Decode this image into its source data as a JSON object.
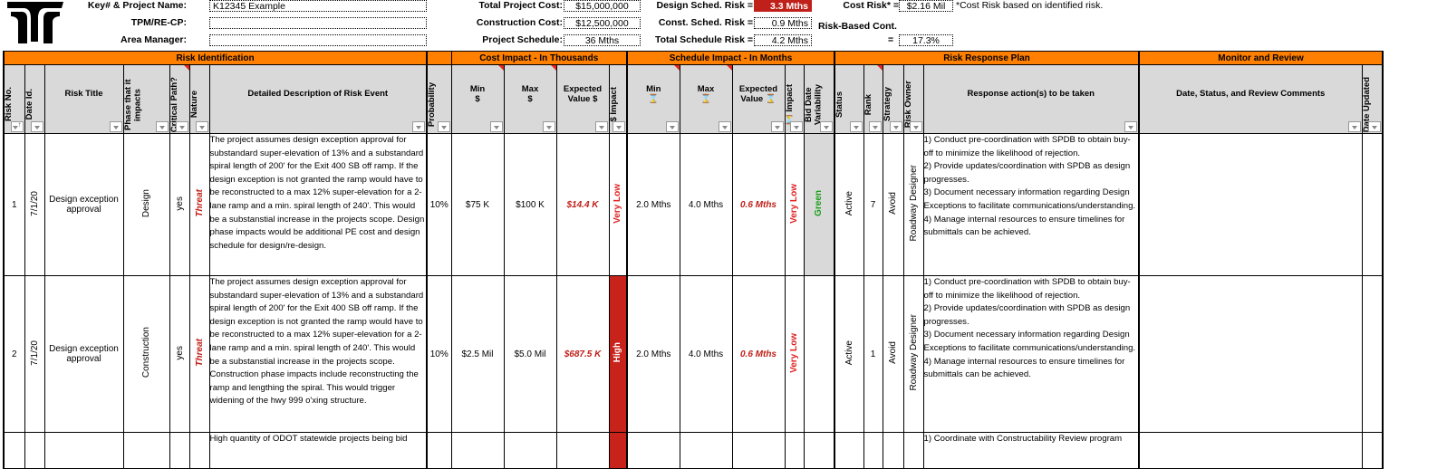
{
  "header": {
    "logo_icon": "odot-logo-icon",
    "fields_left": [
      {
        "label": "Key# & Project Name:",
        "value": "K12345 Example"
      },
      {
        "label": "TPM/RE-CP:",
        "value": ""
      },
      {
        "label": "Area Manager:",
        "value": ""
      }
    ],
    "fields_mid": [
      {
        "label": "Total Project Cost:",
        "value": "$15,000,000"
      },
      {
        "label": "Construction Cost:",
        "value": "$12,500,000"
      },
      {
        "label": "Project Schedule:",
        "value": "36 Mths"
      }
    ],
    "fields_risk": [
      {
        "label": "Design Sched. Risk =",
        "value": "3.3 Mths",
        "highlight": "#c0201a"
      },
      {
        "label": "Const. Sched. Risk =",
        "value": "0.9 Mths"
      },
      {
        "label": "Total Schedule Risk =",
        "value": "4.2 Mths"
      }
    ],
    "cost_risk": {
      "label": "Cost Risk* =",
      "value": "$2.16 Mil",
      "note": "*Cost Risk based on identified risk."
    },
    "risk_based_cont": {
      "label": "Risk-Based Cont.",
      "eq": "=",
      "value": "17.3%"
    }
  },
  "sections": {
    "risk_identification": "Risk Identification",
    "cost_impact": "Cost Impact - In Thousands",
    "schedule_impact": "Schedule Impact - In Months",
    "risk_response": "Risk Response Plan",
    "monitor_review": "Monitor and Review"
  },
  "columns": {
    "risk_no": "Risk No.",
    "date_id": "Date Id.",
    "risk_title": "Risk Title",
    "phase": "Phase that it impacts",
    "critical_path": "Critical Path?",
    "nature": "Nature",
    "description": "Detailed Description of Risk Event",
    "probability": "Probability",
    "cost_min": "Min\n$",
    "cost_max": "Max\n$",
    "cost_ev": "Expected Value $",
    "cost_impact": "$ Impact",
    "sched_min": "Min\n⌛",
    "sched_max": "Max\n⌛",
    "sched_ev": "Expected Value ⌛",
    "sched_impact": "⌛ Impact",
    "bid_date": "Bid Date Variability",
    "status": "Status",
    "rank": "Rank",
    "strategy": "Strategy",
    "owner": "Risk Owner",
    "response": "Response action(s) to be taken",
    "review": "Date, Status, and Review Comments",
    "updated": "Date Updated"
  },
  "rows": [
    {
      "risk_no": "1",
      "date_id": "7/1/20",
      "risk_title": "Design exception approval",
      "phase": "Design",
      "critical_path": "yes",
      "nature": "Threat",
      "description": "The project assumes design exception approval for substandard super-elevation of 13% and a substandard spiral length of 200' for the Exit 400 SB off ramp. If the design exception is not granted the ramp would have to be reconstructed to a max 12% super-elevation for a 2-lane ramp and a min. spiral length of 240'. This would be a substanstial increase in the projects scope. Design phase impacts would be additional PE cost and design schedule for design/re-design.",
      "probability": "10%",
      "cost_min": "$75 K",
      "cost_max": "$100 K",
      "cost_ev": "$14.4 K",
      "cost_impact": "Very Low",
      "cost_impact_level": "very-low",
      "sched_min": "2.0 Mths",
      "sched_max": "4.0 Mths",
      "sched_ev": "0.6 Mths",
      "sched_impact": "Very Low",
      "bid_date": "Green",
      "status": "Active",
      "rank": "7",
      "strategy": "Avoid",
      "owner": "Roadway Designer",
      "response": "1) Conduct pre-coordination with SPDB to obtain buy-off to minimize the likelihood of rejection.\n2) Provide updates/coordination with SPDB as design progresses.\n3) Document necessary information regarding Design Exceptions to facilitate communications/understanding.\n4) Manage internal resources to ensure timelines for submittals can be achieved.",
      "review": "",
      "updated": ""
    },
    {
      "risk_no": "2",
      "date_id": "7/1/20",
      "risk_title": "Design exception approval",
      "phase": "Construction",
      "critical_path": "yes",
      "nature": "Threat",
      "description": "The project assumes design exception approval for substandard super-elevation of 13% and a substandard spiral length of 200' for the Exit 400 SB off ramp. If the design exception is not granted the ramp would have to be reconstructed to a max 12% super-elevation for a 2-lane ramp and a min. spiral length of 240'. This would be a substanstial increase in the projects scope. Construction phase impacts include reconstructing the ramp and lengthing the spiral. This would trigger widening of the hwy 999 o'xing structure.",
      "probability": "10%",
      "cost_min": "$2.5 Mil",
      "cost_max": "$5.0 Mil",
      "cost_ev": "$687.5 K",
      "cost_impact": "High",
      "cost_impact_level": "high",
      "sched_min": "2.0 Mths",
      "sched_max": "4.0 Mths",
      "sched_ev": "0.6 Mths",
      "sched_impact": "Very Low",
      "bid_date": "",
      "status": "Active",
      "rank": "1",
      "strategy": "Avoid",
      "owner": "Roadway Designer",
      "response": "1) Conduct pre-coordination with SPDB to obtain buy-off to minimize the likelihood of rejection.\n2) Provide updates/coordination with SPDB as design progresses.\n3) Document necessary information regarding Design Exceptions to facilitate communications/understanding.\n4) Manage internal resources to ensure timelines for submittals can be achieved.",
      "review": "",
      "updated": ""
    },
    {
      "description": "High quantity of ODOT statewide projects being bid",
      "cost_impact_level": "high",
      "response": "1) Coordinate with Constructability Review program"
    }
  ],
  "colors": {
    "section_header": "#ff7f00",
    "column_header": "#d9d9d9",
    "high": "#c7231a",
    "threat": "#c0201a",
    "green": "#1aa01a"
  }
}
